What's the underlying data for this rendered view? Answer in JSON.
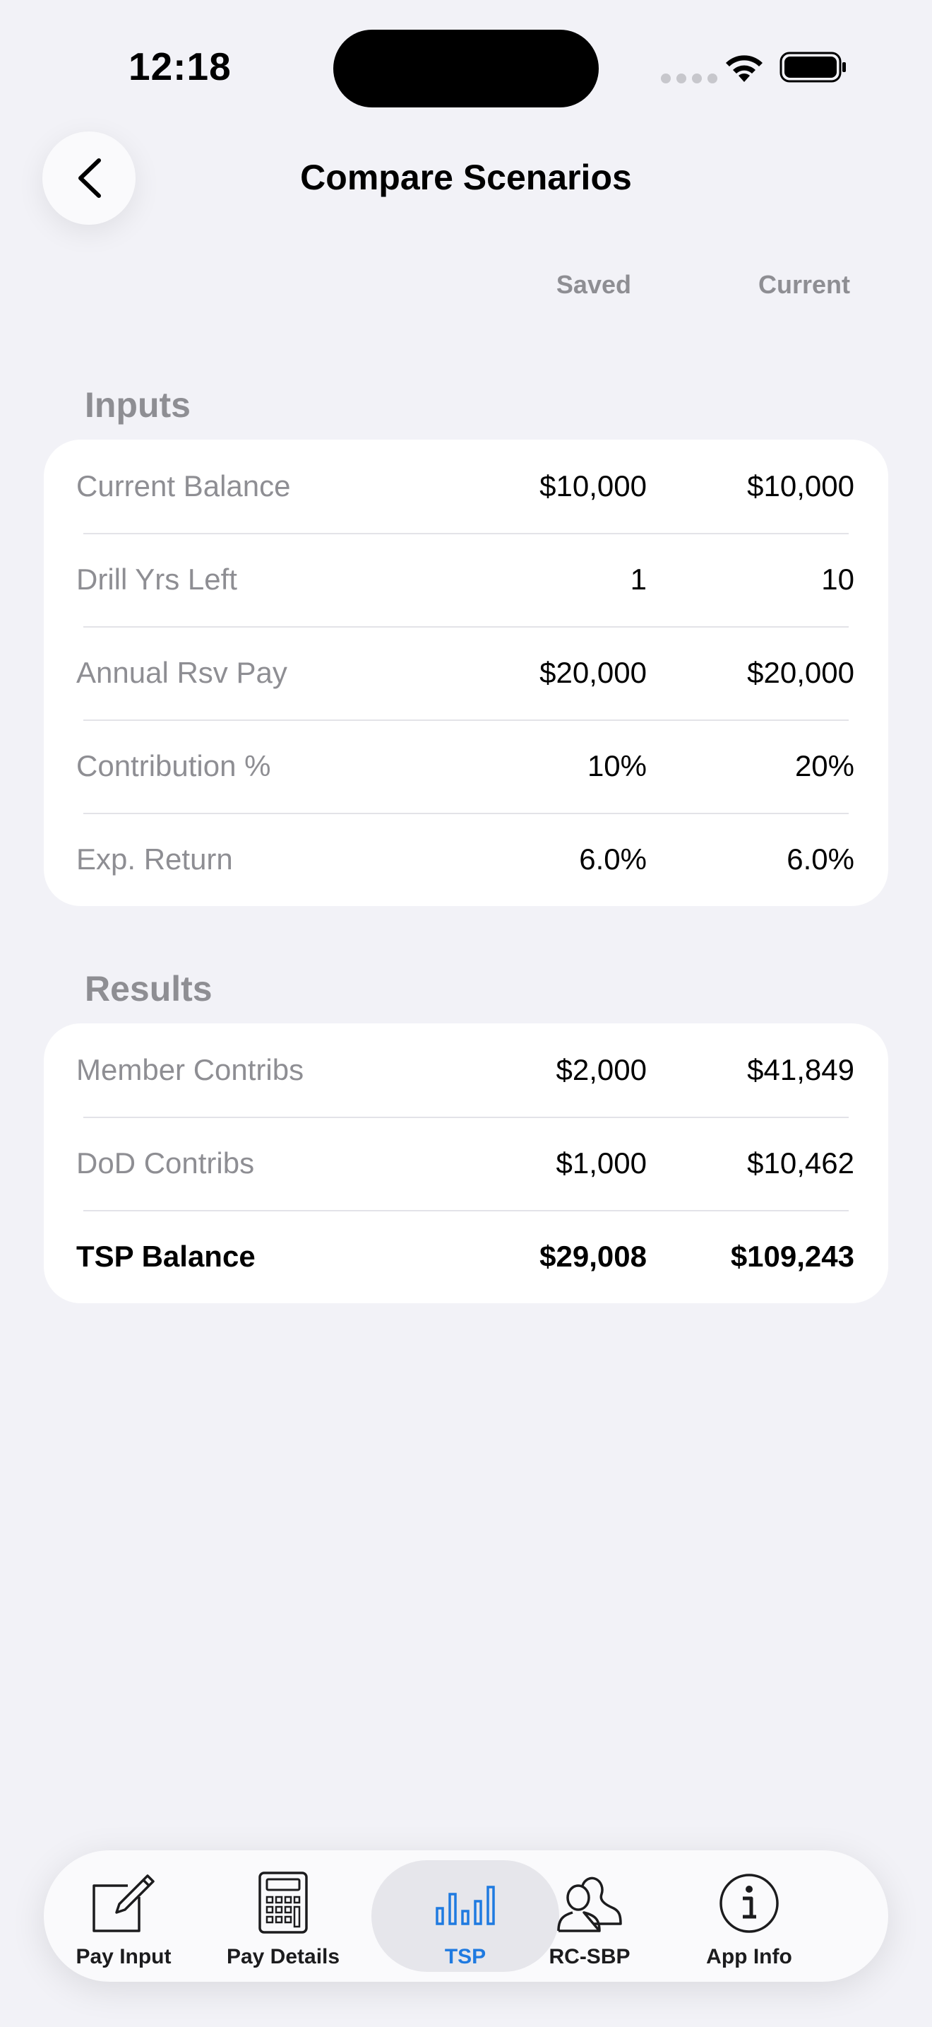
{
  "status_bar": {
    "time": "12:18"
  },
  "nav": {
    "title": "Compare Scenarios",
    "back_icon": "chevron-left-icon"
  },
  "columns": {
    "saved": "Saved",
    "current": "Current"
  },
  "inputs": {
    "title": "Inputs",
    "rows": [
      {
        "label": "Current Balance",
        "saved": "$10,000",
        "current": "$10,000"
      },
      {
        "label": "Drill Yrs Left",
        "saved": "1",
        "current": "10"
      },
      {
        "label": "Annual Rsv Pay",
        "saved": "$20,000",
        "current": "$20,000"
      },
      {
        "label": "Contribution %",
        "saved": "10%",
        "current": "20%"
      },
      {
        "label": "Exp. Return",
        "saved": "6.0%",
        "current": "6.0%"
      }
    ]
  },
  "results": {
    "title": "Results",
    "rows": [
      {
        "label": "Member Contribs",
        "saved": "$2,000",
        "current": "$41,849"
      },
      {
        "label": "DoD Contribs",
        "saved": "$1,000",
        "current": "$10,462"
      },
      {
        "label": "TSP Balance",
        "saved": "$29,008",
        "current": "$109,243"
      }
    ]
  },
  "tab_bar": {
    "active_color": "#1f7ae0",
    "tabs": [
      {
        "label": "Pay Input",
        "icon": "edit-icon"
      },
      {
        "label": "Pay Details",
        "icon": "calculator-icon"
      },
      {
        "label": "TSP",
        "icon": "bar-chart-icon",
        "active": true
      },
      {
        "label": "RC-SBP",
        "icon": "people-icon"
      },
      {
        "label": "App Info",
        "icon": "info-icon"
      }
    ]
  }
}
